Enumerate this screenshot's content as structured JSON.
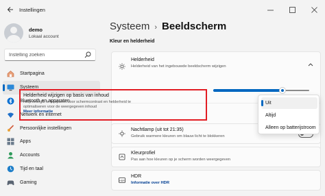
{
  "window": {
    "title": "Instellingen",
    "back_icon": "back-arrow-icon",
    "controls": [
      "minimize-icon",
      "maximize-icon",
      "close-icon"
    ]
  },
  "user": {
    "name": "demo",
    "account": "Lokaal account"
  },
  "search": {
    "placeholder": "Instelling zoeken"
  },
  "nav": {
    "items": [
      {
        "label": "Startpagina",
        "icon": "home-icon",
        "active": false
      },
      {
        "label": "Systeem",
        "icon": "monitor-icon",
        "active": true
      },
      {
        "label": "Bluetooth en apparaten",
        "icon": "bluetooth-icon",
        "active": false
      },
      {
        "label": "Netwerk en internet",
        "icon": "wifi-icon",
        "active": false
      },
      {
        "label": "Persoonlijke instellingen",
        "icon": "brush-icon",
        "active": false
      },
      {
        "label": "Apps",
        "icon": "apps-icon",
        "active": false
      },
      {
        "label": "Accounts",
        "icon": "person-icon",
        "active": false
      },
      {
        "label": "Tijd en taal",
        "icon": "globe-clock-icon",
        "active": false
      },
      {
        "label": "Gaming",
        "icon": "gamepad-icon",
        "active": false
      }
    ]
  },
  "breadcrumb": {
    "parent": "Systeem",
    "separator": "›",
    "current": "Beeldscherm"
  },
  "section_title": "Kleur en helderheid",
  "brightness": {
    "title": "Helderheid",
    "description": "Helderheid van het ingebouwde beeldscherm wijzigen",
    "level": 0.72
  },
  "adaptive": {
    "title": "Helderheid wijzigen op basis van inhoud",
    "description_line1": "Help energie te besparen door schermcontrast en helderheid te",
    "description_line2": "optimaliseren voor de weergegeven inhoud",
    "link": "Meer informatie"
  },
  "dropdown": {
    "options": [
      "Uit",
      "Altijd",
      "Alleen op batterijstroom"
    ],
    "selected": "Uit"
  },
  "night_light": {
    "title": "Nachtlamp (uit tot 21:35)",
    "description": "Gebruik warmere kleuren om blauw licht te blokkeren"
  },
  "color_profile": {
    "title": "Kleurprofiel",
    "description": "Pas aan hoe kleuren op je scherm worden weergegeven"
  },
  "hdr": {
    "title": "HDR",
    "link": "Informatie over HDR"
  },
  "colors": {
    "accent": "#0067c0",
    "highlight_border": "#e21c23",
    "link": "#003e92"
  }
}
